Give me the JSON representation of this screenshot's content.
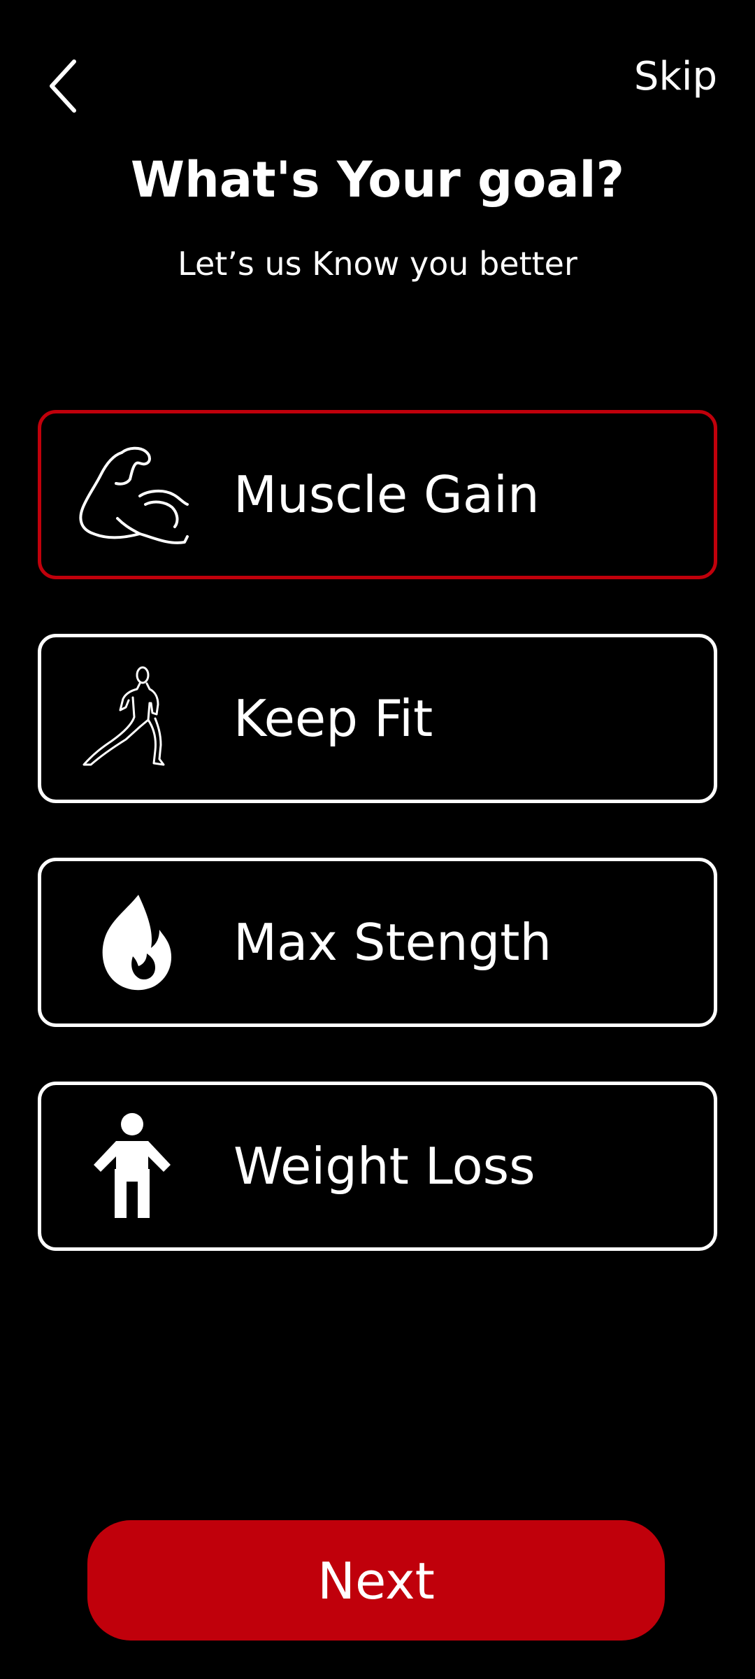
{
  "header": {
    "back_icon": "chevron-left-icon",
    "skip_label": "Skip"
  },
  "title": "What's  Your goal?",
  "subtitle": "Let’s us Know you better",
  "goals": [
    {
      "label": "Muscle Gain",
      "icon": "flexed-bicep-icon",
      "selected": true
    },
    {
      "label": "Keep Fit",
      "icon": "stretching-person-icon",
      "selected": false
    },
    {
      "label": "Max Stength",
      "icon": "flame-icon",
      "selected": false
    },
    {
      "label": "Weight Loss",
      "icon": "person-icon",
      "selected": false
    }
  ],
  "next_label": "Next",
  "colors": {
    "background": "#000000",
    "accent": "#c0000b",
    "text": "#ffffff"
  }
}
